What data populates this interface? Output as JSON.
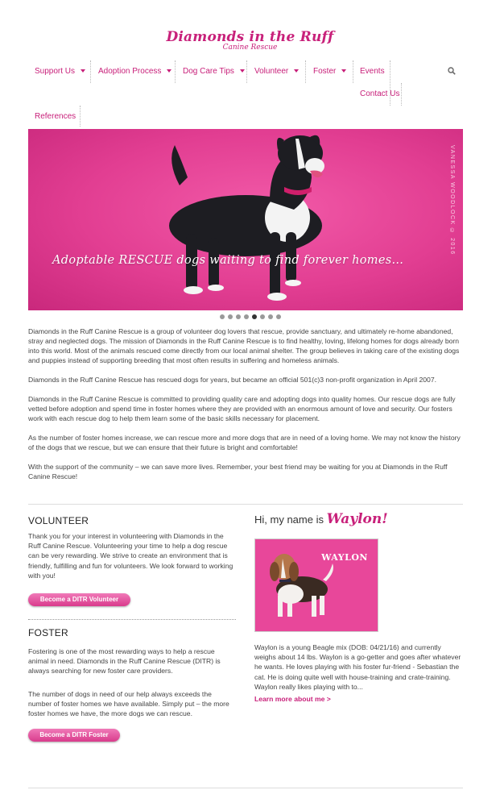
{
  "logo": {
    "main": "Diamonds in the Ruff",
    "sub": "Canine Rescue"
  },
  "nav": {
    "items": [
      {
        "label": "Support Us",
        "dropdown": true
      },
      {
        "label": "Adoption Process",
        "dropdown": true
      },
      {
        "label": "Dog Care Tips",
        "dropdown": true
      },
      {
        "label": "Volunteer",
        "dropdown": true
      },
      {
        "label": "Foster",
        "dropdown": true
      },
      {
        "label": "Events",
        "dropdown": false
      },
      {
        "label": "Contact Us",
        "dropdown": false
      },
      {
        "label": "References",
        "dropdown": false
      }
    ],
    "search_icon": "search-icon"
  },
  "hero": {
    "caption": "Adoptable RESCUE dogs waiting to find forever homes...",
    "credit": "VANESSA WOODLOCK © 2016",
    "slide_count": 8,
    "active_slide": 5
  },
  "intro": {
    "paragraphs": [
      "Diamonds in the Ruff Canine Rescue is a group of volunteer dog lovers that rescue, provide sanctuary, and ultimately re-home abandoned, stray and neglected dogs. The mission of Diamonds in the Ruff Canine Rescue is to find healthy, loving, lifelong homes for dogs already born into this world. Most of the animals rescued come directly from our local animal shelter. The group believes in taking care of the existing dogs and puppies instead of supporting breeding that most often results in suffering and homeless animals.",
      "Diamonds in the Ruff Canine Rescue has rescued dogs for years, but became an official 501(c)3 non-profit organization in April 2007.",
      "Diamonds in the Ruff Canine Rescue is committed to providing quality care and adopting dogs into quality homes. Our rescue dogs are fully vetted before adoption and spend time in foster homes where they are provided with an enormous amount of love and security. Our fosters work with each rescue dog to help them learn some of the basic skills necessary for placement.",
      "As the number of foster homes increase, we can rescue more and more dogs that are in need of a loving home. We may not know the history of the dogs that we rescue, but we can ensure that their future is bright and comfortable!",
      "With the support of the community – we can save more lives. Remember, your best friend may be waiting for you at Diamonds in the Ruff Canine Rescue!"
    ]
  },
  "volunteer": {
    "heading": "VOLUNTEER",
    "text": "Thank you for your interest in volunteering with Diamonds in the Ruff Canine Rescue. Volunteering your time to help a dog rescue can be very rewarding. We strive to create an environment that is friendly, fulfilling and fun for volunteers. We look forward to working with you!",
    "button": "Become a DITR Volunteer"
  },
  "foster": {
    "heading": "FOSTER",
    "text1": "Fostering is one of the most rewarding ways to help a rescue animal in need. Diamonds in the Ruff Canine Rescue (DITR) is always searching for new foster care providers.",
    "text2": "The number of dogs in need of our help always exceeds the number of foster homes we have available. Simply put – the more foster homes we have, the more dogs we can rescue.",
    "button": "Become a DITR Foster"
  },
  "featured": {
    "title_prefix": "Hi, my name is",
    "name": "Waylon!",
    "photo_label": "WAYLON",
    "text": "Waylon is a young Beagle mix (DOB: 04/21/16) and currently weighs about 14 lbs. Waylon is a go-getter and goes after whatever he wants. He loves playing with his foster fur-friend - Sebastian the cat. He is doing quite well with house-training and crate-training. Waylon really likes playing with to...",
    "link": "Learn more about me >"
  },
  "colors": {
    "accent": "#c8207a",
    "hero_bg": "#e23e92"
  }
}
